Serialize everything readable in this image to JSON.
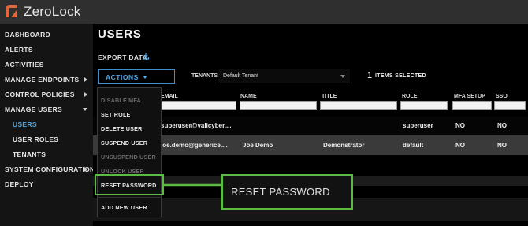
{
  "app": {
    "title": "ZeroLock"
  },
  "sidebar": {
    "items": [
      {
        "label": "DASHBOARD"
      },
      {
        "label": "ALERTS"
      },
      {
        "label": "ACTIVITIES"
      },
      {
        "label": "MANAGE ENDPOINTS"
      },
      {
        "label": "CONTROL POLICIES"
      },
      {
        "label": "MANAGE USERS"
      },
      {
        "label": "USERS"
      },
      {
        "label": "USER ROLES"
      },
      {
        "label": "TENANTS"
      },
      {
        "label": "SYSTEM CONFIGURATION"
      },
      {
        "label": "DEPLOY"
      }
    ]
  },
  "main": {
    "title": "USERS",
    "export_label": "EXPORT DATA",
    "actions_label": "ACTIONS",
    "tenants_label": "TENANTS:",
    "tenant_value": "Default Tenant",
    "selected_count": "1",
    "selected_text": "ITEMS SELECTED"
  },
  "table": {
    "columns": [
      "EMAIL",
      "NAME",
      "TITLE",
      "ROLE",
      "MFA SETUP",
      "SSO"
    ],
    "rows": [
      {
        "email": "superuser@valicyber....",
        "name": "",
        "title": "",
        "role": "superuser",
        "mfa": "NO",
        "sso": "NO"
      },
      {
        "email": "joe.demo@genericе....",
        "name": "Joe Demo",
        "title": "Demonstrator",
        "role": "default",
        "mfa": "NO",
        "sso": "NO"
      }
    ]
  },
  "actions_menu": {
    "items": [
      {
        "label": "DISABLE MFA",
        "enabled": false
      },
      {
        "label": "SET ROLE",
        "enabled": true
      },
      {
        "label": "DELETE USER",
        "enabled": true
      },
      {
        "label": "SUSPEND USER",
        "enabled": true
      },
      {
        "label": "UNSUSPEND USER",
        "enabled": false
      },
      {
        "label": "UNLOCK USER",
        "enabled": false
      },
      {
        "label": "RESET PASSWORD",
        "enabled": true
      },
      {
        "label": "ADD NEW USER",
        "enabled": true
      }
    ]
  },
  "callout": {
    "label": "RESET PASSWORD"
  },
  "colors": {
    "accent": "#4fa8e8",
    "highlight": "#5dbb45",
    "logo": "#e2673a"
  },
  "icons": {
    "logo": "zerolock-logo-icon",
    "export": "download-icon"
  }
}
